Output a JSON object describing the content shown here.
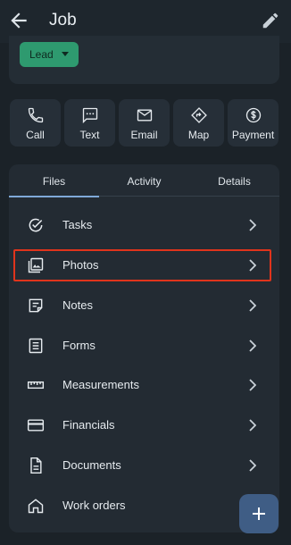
{
  "appbar": {
    "title": "Job",
    "back_icon": "arrow-left-icon",
    "edit_icon": "pencil-icon"
  },
  "lead": {
    "label": "Lead",
    "color": "#2e9a6f"
  },
  "actions": [
    {
      "label": "Call",
      "icon": "phone-icon"
    },
    {
      "label": "Text",
      "icon": "message-icon"
    },
    {
      "label": "Email",
      "icon": "mail-icon"
    },
    {
      "label": "Map",
      "icon": "directions-icon"
    },
    {
      "label": "Payment",
      "icon": "dollar-icon"
    }
  ],
  "tabs": [
    {
      "label": "Files",
      "active": true
    },
    {
      "label": "Activity"
    },
    {
      "label": "Details"
    }
  ],
  "files": [
    {
      "label": "Tasks",
      "icon": "check-circle-icon"
    },
    {
      "label": "Photos",
      "icon": "photos-icon",
      "highlighted": true
    },
    {
      "label": "Notes",
      "icon": "note-icon"
    },
    {
      "label": "Forms",
      "icon": "form-icon"
    },
    {
      "label": "Measurements",
      "icon": "ruler-icon"
    },
    {
      "label": "Financials",
      "icon": "card-icon"
    },
    {
      "label": "Documents",
      "icon": "document-icon"
    },
    {
      "label": "Work orders",
      "icon": "home-icon"
    }
  ],
  "fab_icon": "plus-icon",
  "colors": {
    "background": "#1b2228",
    "panel": "#232b33",
    "highlight": "#e0341c",
    "fab": "#3f5d85",
    "tab_indicator": "#7fa9d9"
  }
}
